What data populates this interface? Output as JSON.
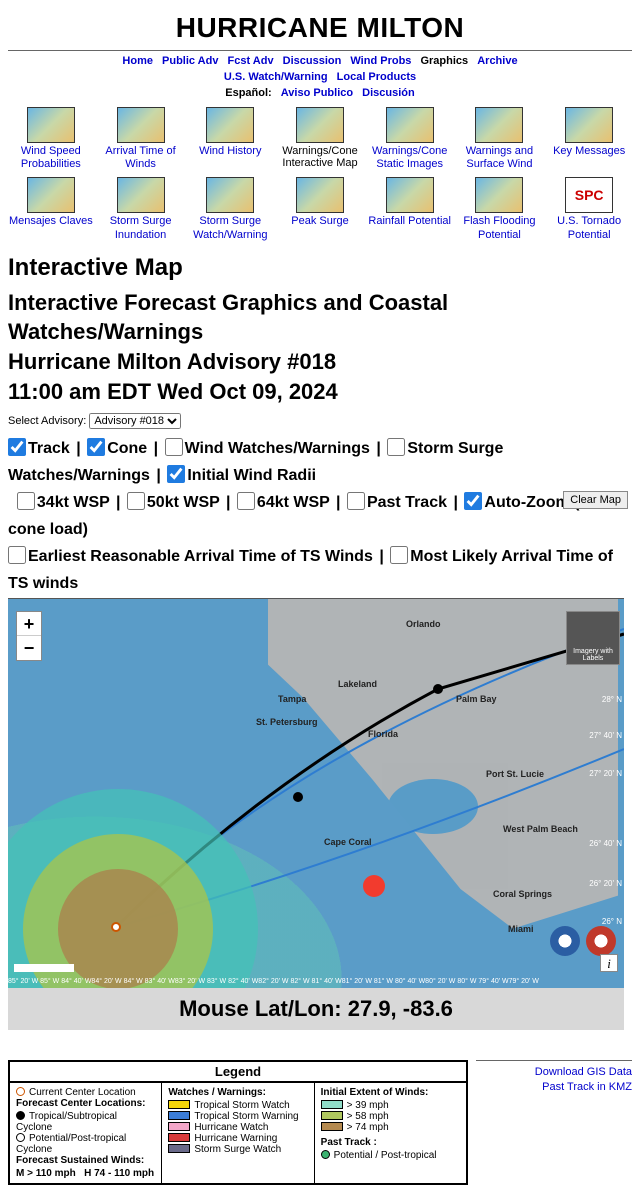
{
  "title": "HURRICANE MILTON",
  "nav1": {
    "home": "Home",
    "public_adv": "Public Adv",
    "fcst_adv": "Fcst Adv",
    "discussion": "Discussion",
    "wind_probs": "Wind Probs",
    "graphics": "Graphics",
    "archive": "Archive"
  },
  "nav2": {
    "us_watch": "U.S. Watch/Warning",
    "local": "Local Products"
  },
  "nav3": {
    "prefix": "Español:",
    "aviso": "Aviso Publico",
    "discusion": "Discusión"
  },
  "thumbs": [
    {
      "label": "Wind Speed Probabilities",
      "link": true
    },
    {
      "label": "Arrival Time of Winds",
      "link": true
    },
    {
      "label": "Wind History",
      "link": true
    },
    {
      "label": "Warnings/Cone Interactive Map",
      "link": false
    },
    {
      "label": "Warnings/Cone Static Images",
      "link": true
    },
    {
      "label": "Warnings and Surface Wind",
      "link": true
    },
    {
      "label": "Key Messages",
      "link": true
    },
    {
      "label": "Mensajes Claves",
      "link": true
    },
    {
      "label": "Storm Surge Inundation",
      "link": true
    },
    {
      "label": "Storm Surge Watch/Warning",
      "link": true
    },
    {
      "label": "Peak Surge",
      "link": true
    },
    {
      "label": "Rainfall Potential",
      "link": true
    },
    {
      "label": "Flash Flooding Potential",
      "link": true
    },
    {
      "label": "U.S. Tornado Potential",
      "link": true,
      "spc": true
    }
  ],
  "section_heading": "Interactive Map",
  "fcst_line1": "Interactive Forecast Graphics and Coastal Watches/Warnings",
  "fcst_line2": "Hurricane Milton Advisory #018",
  "fcst_line3": "11:00 am EDT Wed Oct 09, 2024",
  "advisory_label": "Select Advisory:",
  "advisory_selected": "Advisory #018",
  "layers": {
    "track": "Track",
    "cone": "Cone",
    "wind_ww": "Wind Watches/Warnings",
    "surge_ww": "Storm Surge Watches/Warnings",
    "init_radii": "Initial Wind Radii",
    "wsp34": "34kt WSP",
    "wsp50": "50kt WSP",
    "wsp64": "64kt WSP",
    "past_track": "Past Track",
    "autozoom": "Auto-Zoom (on cone load)",
    "earliest": "Earliest Reasonable Arrival Time of TS Winds",
    "mostlikely": "Most Likely Arrival Time of TS winds"
  },
  "clear_map": "Clear Map",
  "map": {
    "imagery_label": "Imagery with Labels",
    "zoom_in": "+",
    "zoom_out": "−",
    "info": "i",
    "cities": {
      "orlando": "Orlando",
      "tampa": "Tampa",
      "stpete": "St. Petersburg",
      "lakeland": "Lakeland",
      "florida": "Florida",
      "palmbay": "Palm Bay",
      "portlucie": "Port St. Lucie",
      "westpalm": "West Palm Beach",
      "capecoral": "Cape Coral",
      "coral": "Coral Springs",
      "miami": "Miami"
    },
    "lats": [
      "28° N",
      "27° 40' N",
      "27° 20' N",
      "26° 40' N",
      "26° 20' N",
      "26° N"
    ],
    "lonbar": "85° 20' W  85° W  84° 40' W84° 20' W  84° W  83° 40' W83° 20' W  83° W  82° 40' W82° 20' W  82° W  81° 40' W81° 20' W  81° W  80° 40' W80° 20' W  80° W  79° 40' W79° 20' W"
  },
  "mouse_bar": "Mouse Lat/Lon: 27.9, -83.6",
  "legend": {
    "title": "Legend",
    "col1": {
      "current_center": "Current Center Location",
      "fcst_loc_hdr": "Forecast Center Locations:",
      "trop": "Tropical/Subtropical Cyclone",
      "post": "Potential/Post-tropical Cyclone",
      "sust_hdr": "Forecast Sustained Winds:",
      "m": "M  > 110 mph",
      "h": "H  74 - 110 mph"
    },
    "col2": {
      "hdr": "Watches / Warnings:",
      "tsw": "Tropical Storm Watch",
      "tswarn": "Tropical Storm Warning",
      "hw": "Hurricane Watch",
      "hwarn": "Hurricane Warning",
      "ssw": "Storm Surge Watch"
    },
    "col3": {
      "hdr": "Initial Extent of Winds:",
      "w39": "> 39 mph",
      "w58": "> 58 mph",
      "w74": "> 74 mph",
      "past_hdr": "Past Track :",
      "past_item": "Potential / Post-tropical"
    }
  },
  "rightlinks": {
    "gis": "Download GIS Data",
    "kmz": "Past Track in KMZ"
  }
}
